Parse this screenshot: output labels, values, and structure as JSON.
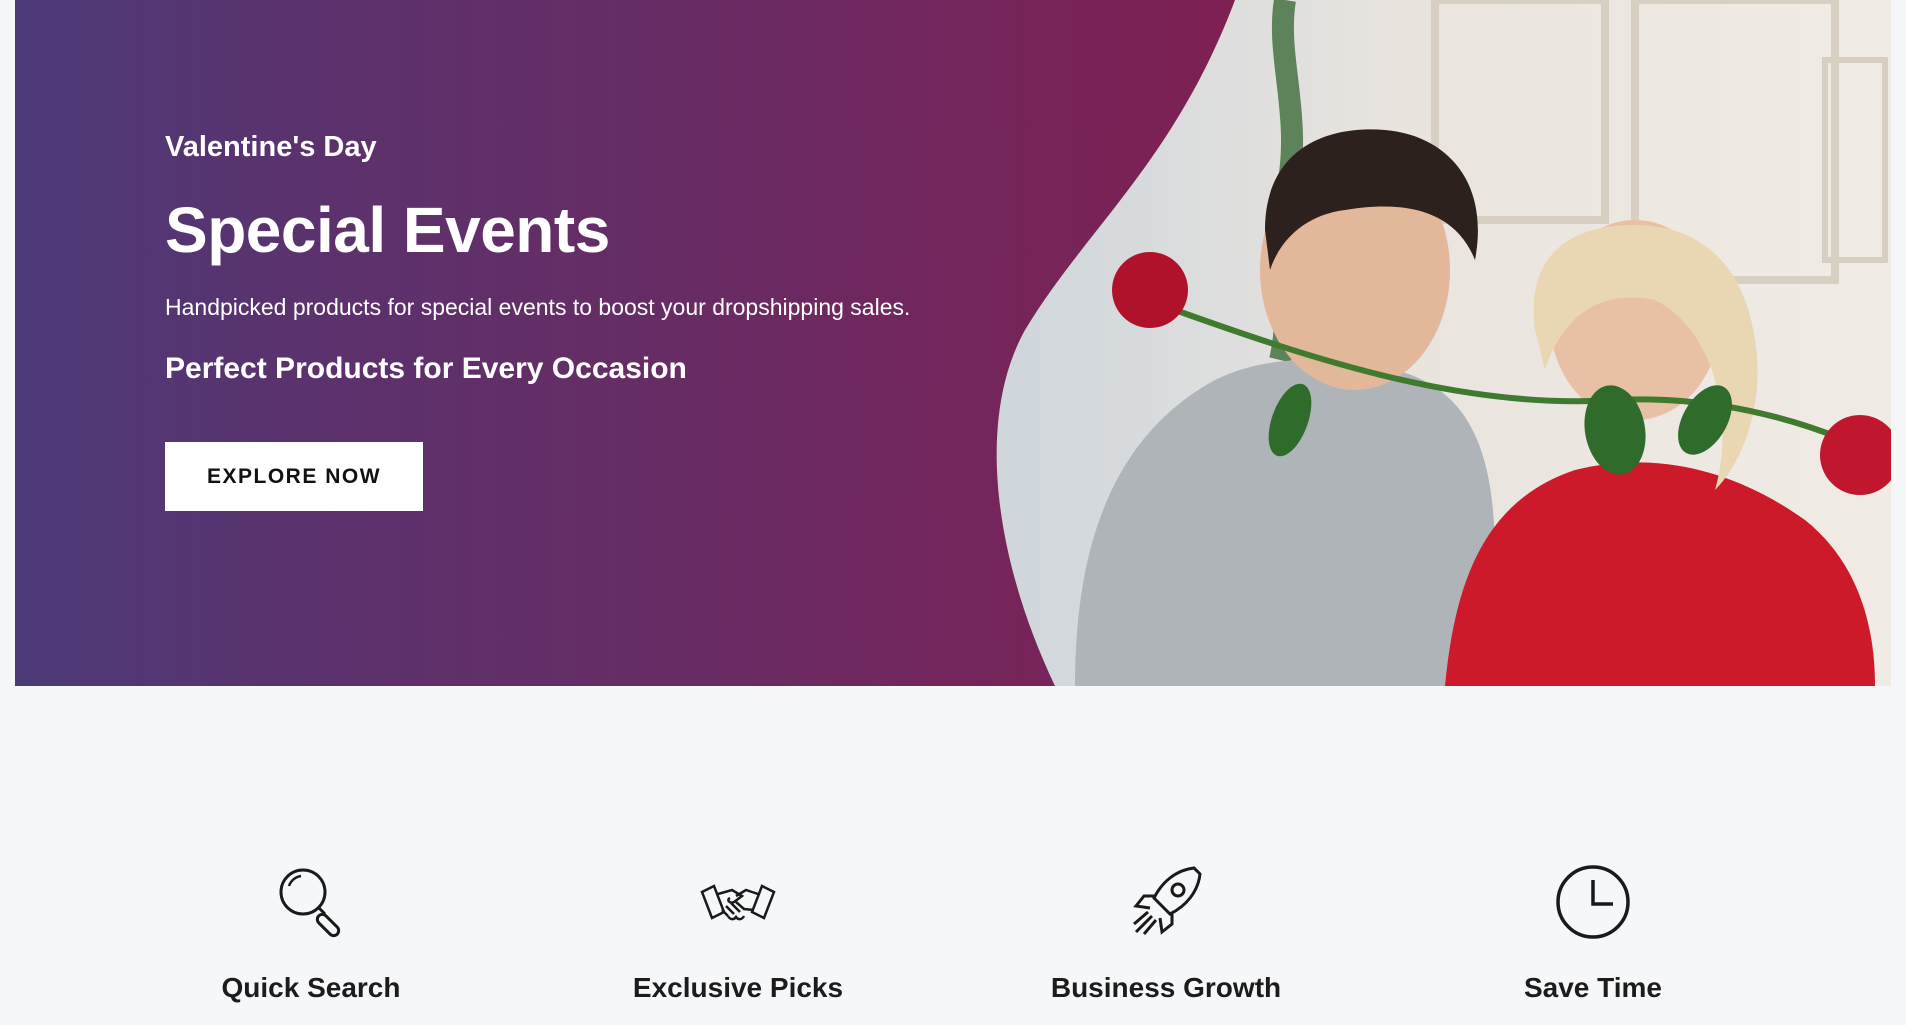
{
  "hero": {
    "eyebrow": "Valentine's Day",
    "title": "Special Events",
    "description": "Handpicked products for special events to boost your dropshipping sales.",
    "subheading": "Perfect Products for Every Occasion",
    "cta_label": "EXPLORE NOW",
    "image": "couple-with-roses-photo",
    "gradient_colors": [
      "#4c3a78",
      "#8b1a48"
    ]
  },
  "features": [
    {
      "icon": "search-icon",
      "label": "Quick Search"
    },
    {
      "icon": "handshake-icon",
      "label": "Exclusive Picks"
    },
    {
      "icon": "rocket-icon",
      "label": "Business Growth"
    },
    {
      "icon": "clock-icon",
      "label": "Save Time"
    }
  ],
  "colors": {
    "page_background": "#f6f7f9",
    "text_dark": "#1c1c1c",
    "button_background": "#ffffff"
  }
}
